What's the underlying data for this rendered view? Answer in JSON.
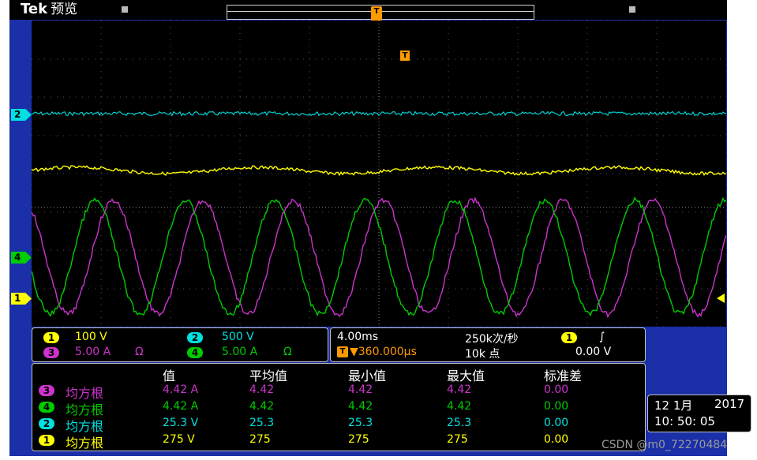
{
  "header": {
    "brand": "Tek",
    "mode": "预览"
  },
  "markers": {
    "trigger": "T",
    "ch2": "2",
    "ch4": "4",
    "ch1": "1"
  },
  "colors": {
    "ch1": "#ffff00",
    "ch2": "#00e0e0",
    "ch3": "#cc33cc",
    "ch4": "#00cc00",
    "trigger": "#ff9900"
  },
  "channels": [
    {
      "num": "1",
      "scale": "100 V",
      "extra": ""
    },
    {
      "num": "2",
      "scale": "500 V",
      "extra": ""
    },
    {
      "num": "3",
      "scale": "5.00 A",
      "extra": "Ω"
    },
    {
      "num": "4",
      "scale": "5.00 A",
      "extra": "Ω"
    }
  ],
  "timebase": {
    "time_div": "4.00ms",
    "sample_rate": "250k次/秒",
    "trigger_pos": "▼360.000µs",
    "record_length": "10k 点",
    "trigger_source": "1",
    "trigger_slope": "∫",
    "trigger_level": "0.00 V"
  },
  "measurements": {
    "headers": [
      "值",
      "平均值",
      "最小值",
      "最大值",
      "标准差"
    ],
    "rows": [
      {
        "ch": "3",
        "type": "均方根",
        "value": "4.42 A",
        "mean": "4.42",
        "min": "4.42",
        "max": "4.42",
        "std": "0.00"
      },
      {
        "ch": "4",
        "type": "均方根",
        "value": "4.42 A",
        "mean": "4.42",
        "min": "4.42",
        "max": "4.42",
        "std": "0.00"
      },
      {
        "ch": "2",
        "type": "均方根",
        "value": "25.3 V",
        "mean": "25.3",
        "min": "25.3",
        "max": "25.3",
        "std": "0.00"
      },
      {
        "ch": "1",
        "type": "均方根",
        "value": "275 V",
        "mean": "275",
        "min": "275",
        "max": "275",
        "std": "0.00"
      }
    ]
  },
  "clock": {
    "date": "12 1月",
    "year": "2017",
    "time": "10: 50: 05"
  },
  "watermark": "CSDN @m0_72270484"
}
